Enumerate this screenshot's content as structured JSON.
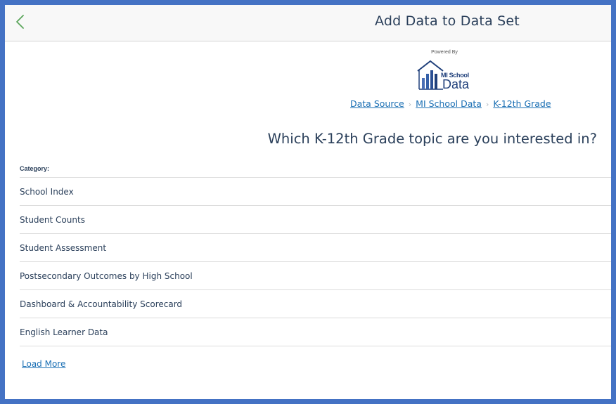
{
  "header": {
    "title": "Add Data to Data Set",
    "back_icon": "chevron-left-icon"
  },
  "logo": {
    "powered_by": "Powered By",
    "brand_small": "MI School",
    "brand_big": "Data"
  },
  "breadcrumb": {
    "items": [
      "Data Source",
      "MI School Data",
      "K-12th Grade"
    ]
  },
  "question": "Which K-12th Grade topic are you interested in?",
  "category": {
    "label": "Category:",
    "items": [
      "School Index",
      "Student Counts",
      "Student Assessment",
      "Postsecondary Outcomes by High School",
      "Dashboard & Accountability Scorecard",
      "English Learner Data"
    ]
  },
  "load_more": "Load More",
  "colors": {
    "frame_border": "#4472c4",
    "link": "#1a6fb4",
    "text": "#2a3f5a",
    "back_icon": "#5aa55a"
  }
}
